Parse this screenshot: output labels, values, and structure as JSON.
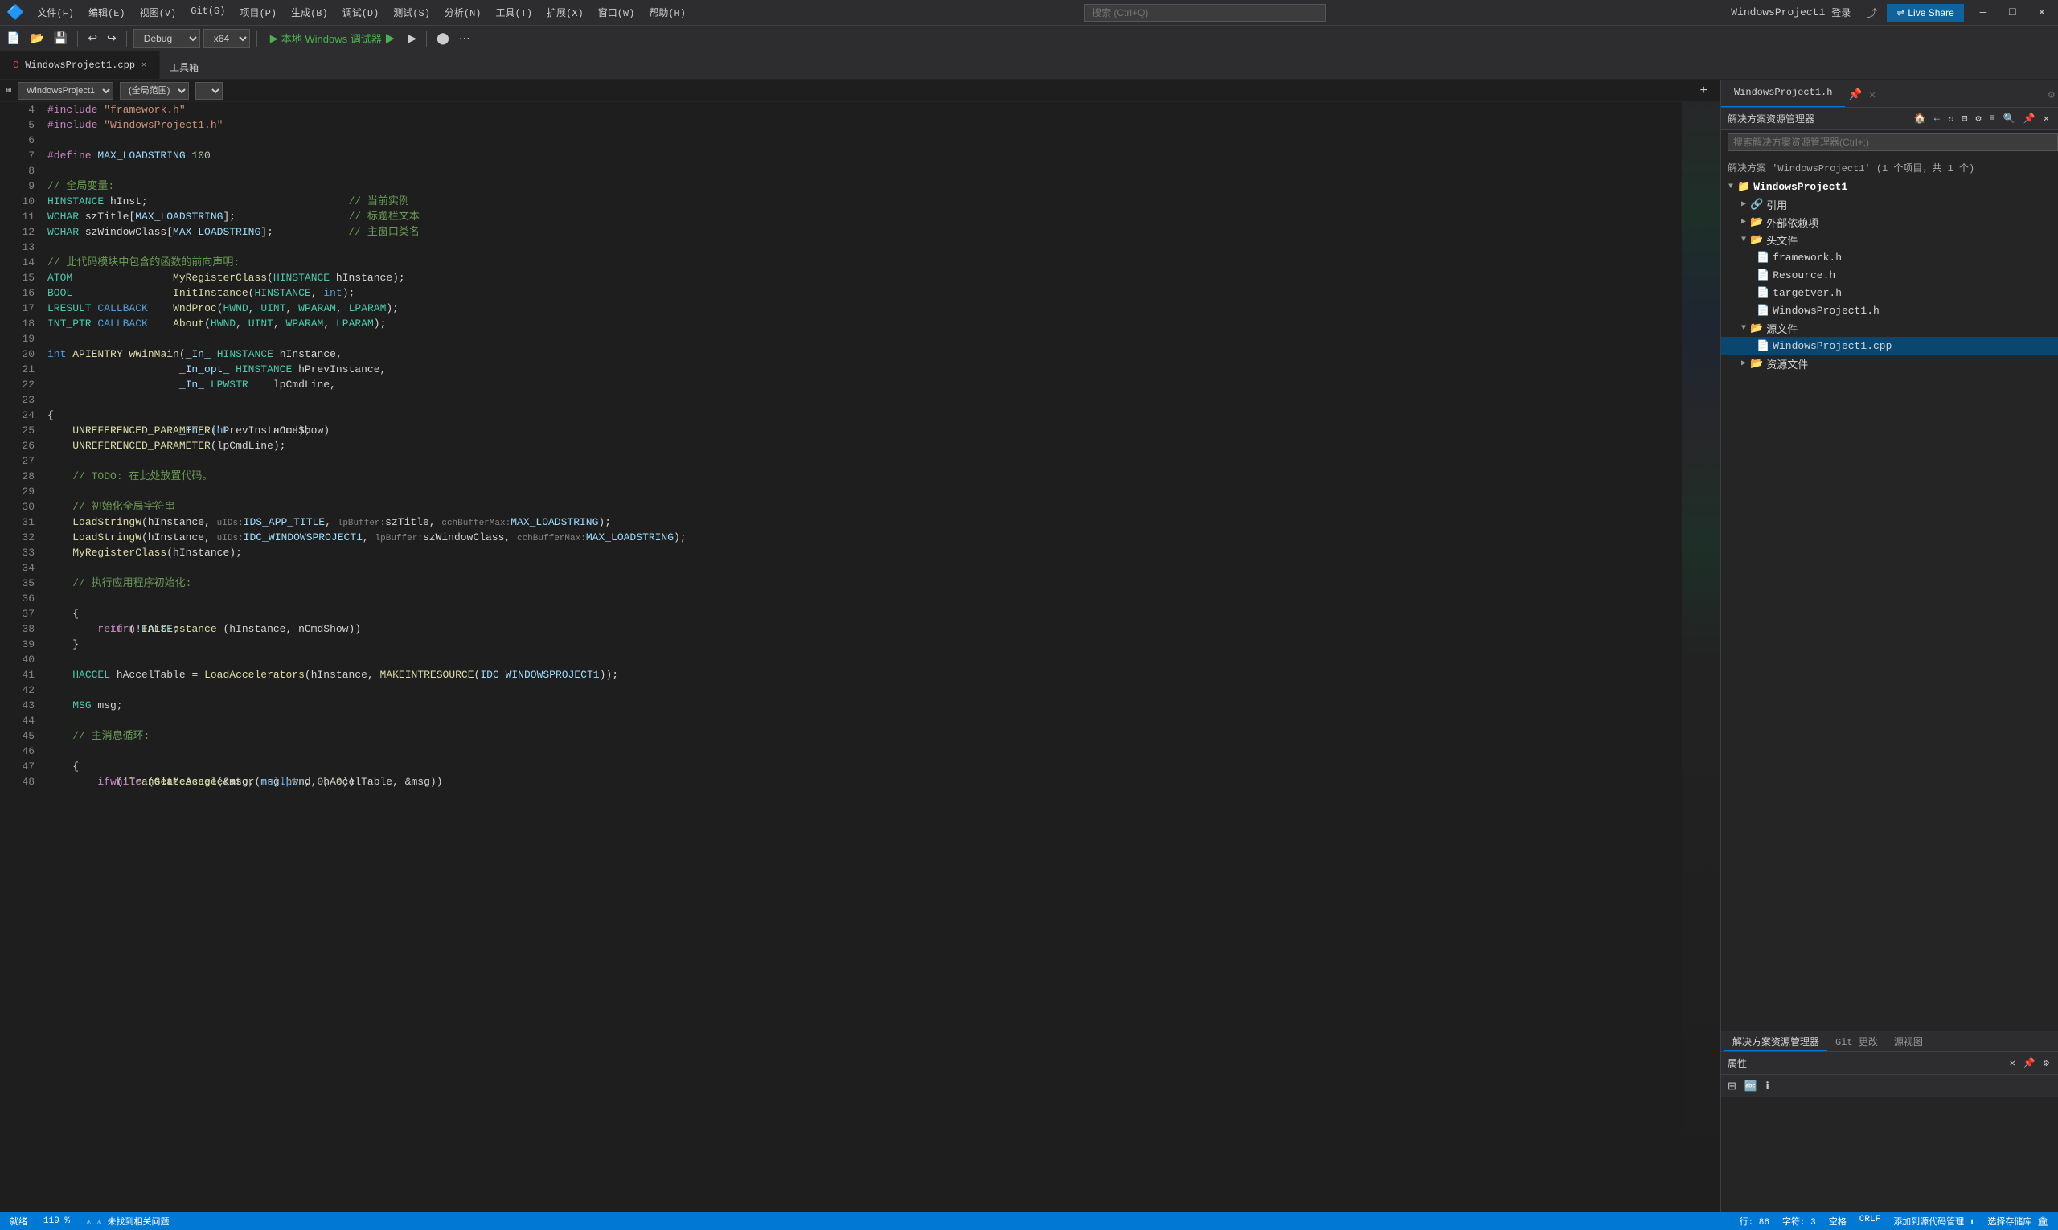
{
  "titlebar": {
    "logo": "🔷",
    "menus": [
      "文件(F)",
      "编辑(E)",
      "视图(V)",
      "Git(G)",
      "项目(P)",
      "生成(B)",
      "调试(D)",
      "测试(S)",
      "分析(N)",
      "工具(T)",
      "扩展(X)",
      "窗口(W)",
      "帮助(H)"
    ],
    "search_placeholder": "搜索 (Ctrl+Q)",
    "project_name": "WindowsProject1",
    "login": "登录",
    "live_share": "Live Share",
    "controls": [
      "—",
      "□",
      "✕"
    ]
  },
  "toolbar": {
    "debug_mode": "Debug",
    "platform": "x64",
    "run_label": "本地 Windows 调试器 ▶",
    "run_label2": "▶"
  },
  "tabs": {
    "editor_tab": "WindowsProject1.cpp",
    "right_tab": "WindowsProject1.h",
    "toolbar_label": "工具箱"
  },
  "editor": {
    "file_label": "WindowsProject1",
    "scope_label": "(全局范围)",
    "lines": [
      {
        "n": 4,
        "code": "#include \"framework.h\"",
        "type": "pp"
      },
      {
        "n": 5,
        "code": "#include \"WindowsProject1.h\"",
        "type": "pp"
      },
      {
        "n": 6,
        "code": ""
      },
      {
        "n": 7,
        "code": "#define MAX_LOADSTRING 100",
        "type": "pp"
      },
      {
        "n": 8,
        "code": ""
      },
      {
        "n": 9,
        "code": "// 全局变量:",
        "type": "cmt"
      },
      {
        "n": 10,
        "code": "HINSTANCE hInst;                                // 当前实例",
        "type": "mixed"
      },
      {
        "n": 11,
        "code": "WCHAR szTitle[MAX_LOADSTRING];                  // 标题栏文本",
        "type": "mixed"
      },
      {
        "n": 12,
        "code": "WCHAR szWindowClass[MAX_LOADSTRING];            // 主窗口类名",
        "type": "mixed"
      },
      {
        "n": 13,
        "code": ""
      },
      {
        "n": 14,
        "code": "// 此代码模块中包含的函数的前向声明:",
        "type": "cmt"
      },
      {
        "n": 15,
        "code": "ATOM                MyRegisterClass(HINSTANCE hInstance);",
        "type": "mixed"
      },
      {
        "n": 16,
        "code": "BOOL                InitInstance(HINSTANCE, int);",
        "type": "mixed"
      },
      {
        "n": 17,
        "code": "LRESULT CALLBACK    WndProc(HWND, UINT, WPARAM, LPARAM);",
        "type": "mixed"
      },
      {
        "n": 18,
        "code": "INT_PTR CALLBACK    About(HWND, UINT, WPARAM, LPARAM);",
        "type": "mixed"
      },
      {
        "n": 19,
        "code": ""
      },
      {
        "n": 20,
        "code": "int APIENTRY wWinMain(_In_ HINSTANCE hInstance,",
        "type": "mixed"
      },
      {
        "n": 21,
        "code": "                     _In_opt_ HINSTANCE hPrevInstance,",
        "type": "mixed"
      },
      {
        "n": 22,
        "code": "                     _In_ LPWSTR    lpCmdLine,",
        "type": "mixed"
      },
      {
        "n": 23,
        "code": "                     _In_ int       nCmdShow)",
        "type": "mixed"
      },
      {
        "n": 24,
        "code": "{"
      },
      {
        "n": 25,
        "code": "    UNREFERENCED_PARAMETER(hPrevInstance);",
        "type": "fn"
      },
      {
        "n": 26,
        "code": "    UNREFERENCED_PARAMETER(lpCmdLine);",
        "type": "fn"
      },
      {
        "n": 27,
        "code": ""
      },
      {
        "n": 28,
        "code": "    // TODO: 在此处放置代码。",
        "type": "cmt"
      },
      {
        "n": 29,
        "code": ""
      },
      {
        "n": 30,
        "code": "    // 初始化全局字符串",
        "type": "cmt"
      },
      {
        "n": 31,
        "code": "    LoadStringW(hInstance, uIDs: IDS_APP_TITLE, lpBuffer: szTitle, cchBufferMax: MAX_LOADSTRING);",
        "type": "fn"
      },
      {
        "n": 32,
        "code": "    LoadStringW(hInstance, uIDs: IDC_WINDOWSPROJECT1, lpBuffer: szWindowClass, cchBufferMax: MAX_LOADSTRING);",
        "type": "fn"
      },
      {
        "n": 33,
        "code": "    MyRegisterClass(hInstance);",
        "type": "fn"
      },
      {
        "n": 34,
        "code": ""
      },
      {
        "n": 35,
        "code": "    // 执行应用程序初始化:",
        "type": "cmt"
      },
      {
        "n": 36,
        "code": "    if (!InitInstance (hInstance, nCmdShow))",
        "type": "mixed"
      },
      {
        "n": 37,
        "code": "    {"
      },
      {
        "n": 38,
        "code": "        return FALSE;",
        "type": "mixed"
      },
      {
        "n": 39,
        "code": "    }"
      },
      {
        "n": 40,
        "code": ""
      },
      {
        "n": 41,
        "code": "    HACCEL hAccelTable = LoadAccelerators(hInstance, MAKEINTRESOURCE(IDC_WINDOWSPROJECT1));",
        "type": "fn"
      },
      {
        "n": 42,
        "code": ""
      },
      {
        "n": 43,
        "code": "    MSG msg;"
      },
      {
        "n": 44,
        "code": ""
      },
      {
        "n": 45,
        "code": "    // 主消息循环:",
        "type": "cmt"
      },
      {
        "n": 46,
        "code": "    while (GetMessage(&msg, nullptr, 0, 0))",
        "type": "mixed"
      },
      {
        "n": 47,
        "code": "    {"
      },
      {
        "n": 48,
        "code": "        if (!TranslateAccelerator(msg.hwnd, hAccelTable, &msg))",
        "type": "mixed"
      }
    ]
  },
  "solution_explorer": {
    "title": "解决方案资源管理器",
    "search_placeholder": "搜索解决方案资源管理器(Ctrl+;)",
    "solution_label": "解决方案 'WindowsProject1' (1 个项目，共 1 个)",
    "project_name": "WindowsProject1",
    "nodes": [
      {
        "label": "引用",
        "type": "folder",
        "level": 2
      },
      {
        "label": "外部依赖项",
        "type": "folder",
        "level": 2
      },
      {
        "label": "头文件",
        "type": "folder",
        "level": 2,
        "expanded": true
      },
      {
        "label": "framework.h",
        "type": "h",
        "level": 3
      },
      {
        "label": "Resource.h",
        "type": "h",
        "level": 3
      },
      {
        "label": "targetver.h",
        "type": "h",
        "level": 3
      },
      {
        "label": "WindowsProject1.h",
        "type": "h",
        "level": 3
      },
      {
        "label": "源文件",
        "type": "folder",
        "level": 2,
        "expanded": true
      },
      {
        "label": "WindowsProject1.cpp",
        "type": "cpp",
        "level": 3
      },
      {
        "label": "资源文件",
        "type": "folder",
        "level": 2
      }
    ]
  },
  "bottom_tabs": {
    "tabs": [
      "解决方案资源管理器",
      "Git 更改",
      "源视图"
    ]
  },
  "properties": {
    "title": "属性"
  },
  "statusbar": {
    "left": [
      "就绪"
    ],
    "warning": "⚠ 未找到相关问题",
    "info": [
      "行: 86",
      "字符: 3",
      "空格",
      "CRLF"
    ],
    "right": [
      "添加到源代码管理 ⬆",
      "选择存储库 🏛"
    ],
    "zoom": "119 %"
  }
}
